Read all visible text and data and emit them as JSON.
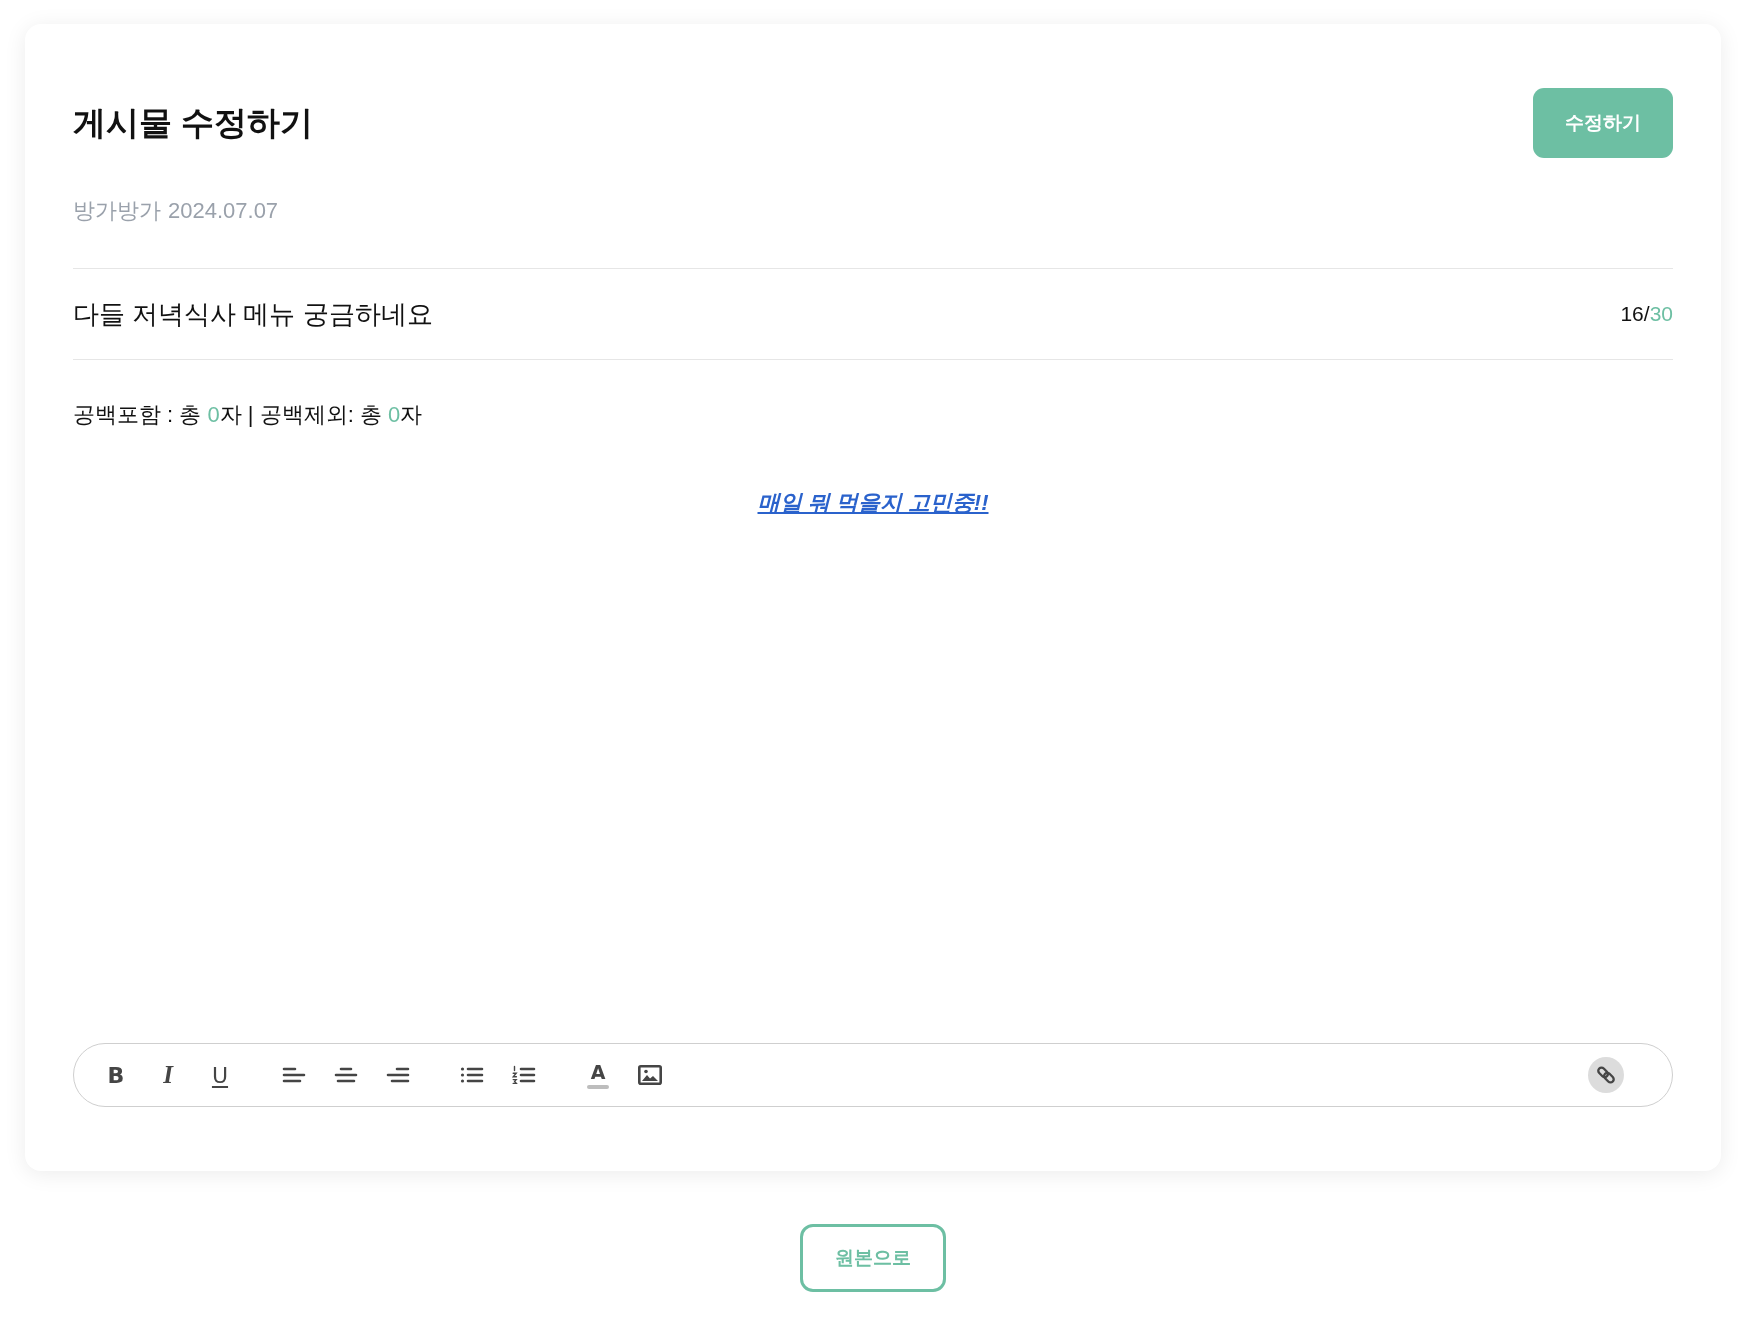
{
  "header": {
    "title": "게시물 수정하기",
    "submit_button": "수정하기"
  },
  "meta": {
    "author": "방가방가",
    "date": "2024.07.07"
  },
  "post_title": {
    "value": "다들 저녁식사 메뉴 궁금하네요",
    "counter": [
      {
        "text": "16/",
        "highlight": false
      },
      {
        "text": "30",
        "highlight": true
      }
    ]
  },
  "char_count": [
    {
      "text": "공백포함 : 총 ",
      "highlight": false
    },
    {
      "text": "0",
      "highlight": true
    },
    {
      "text": "자 | 공백제외: 총 ",
      "highlight": false
    },
    {
      "text": "0",
      "highlight": true
    },
    {
      "text": "자",
      "highlight": false
    }
  ],
  "editor": {
    "content": [
      {
        "kind": "link",
        "text": "매일 뭐 먹을지 고민중!!"
      }
    ]
  },
  "toolbar": {
    "groups": [
      {
        "buttons": [
          {
            "kind": "bold",
            "label": "B",
            "active": false
          },
          {
            "kind": "italic",
            "label": "I",
            "active": false
          },
          {
            "kind": "underline",
            "label": "U",
            "active": false
          }
        ]
      },
      {
        "buttons": [
          {
            "kind": "align-left",
            "active": false
          },
          {
            "kind": "align-center",
            "active": false
          },
          {
            "kind": "align-right",
            "active": false
          }
        ]
      },
      {
        "buttons": [
          {
            "kind": "bullet-list",
            "active": false
          },
          {
            "kind": "numbered-list",
            "active": false
          }
        ]
      },
      {
        "buttons": [
          {
            "kind": "text-color",
            "label": "A",
            "active": false
          },
          {
            "kind": "image",
            "active": false
          }
        ]
      }
    ],
    "trailing": [
      {
        "kind": "link",
        "active": true
      }
    ]
  },
  "footer_button": "원본으로"
}
